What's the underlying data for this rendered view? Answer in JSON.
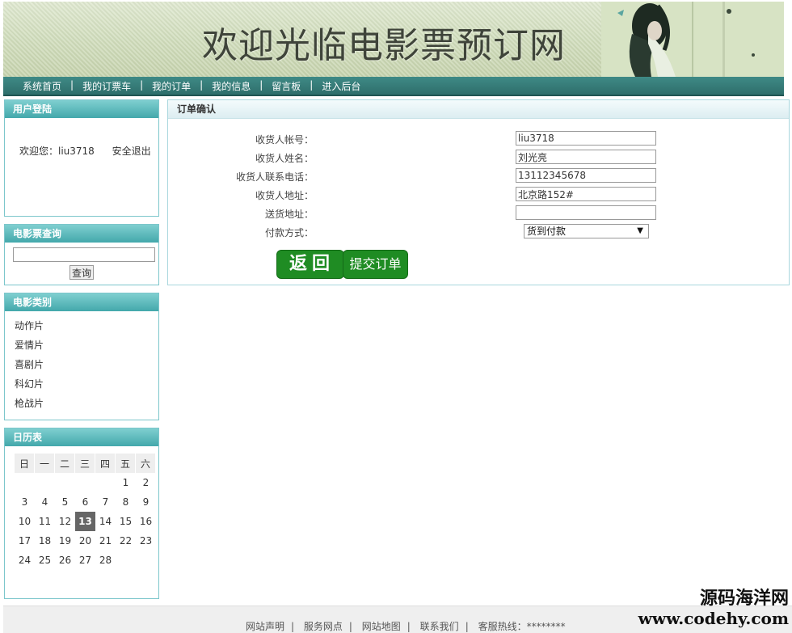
{
  "header": {
    "title": "欢迎光临电影票预订网"
  },
  "nav": {
    "items": [
      "系统首页",
      "我的订票车",
      "我的订单",
      "我的信息",
      "留言板",
      "进入后台"
    ],
    "separator": "|"
  },
  "login": {
    "title": "用户登陆",
    "welcome": "欢迎您：liu3718",
    "logout": "安全退出"
  },
  "search": {
    "title": "电影票查询",
    "input_value": "",
    "button": "查询"
  },
  "categories": {
    "title": "电影类别",
    "items": [
      "动作片",
      "爱情片",
      "喜剧片",
      "科幻片",
      "枪战片"
    ]
  },
  "calendar": {
    "title": "日历表",
    "weekdays": [
      "日",
      "一",
      "二",
      "三",
      "四",
      "五",
      "六"
    ],
    "weeks": [
      [
        "",
        "",
        "",
        "",
        "",
        "1",
        "2"
      ],
      [
        "3",
        "4",
        "5",
        "6",
        "7",
        "8",
        "9"
      ],
      [
        "10",
        "11",
        "12",
        "13",
        "14",
        "15",
        "16"
      ],
      [
        "17",
        "18",
        "19",
        "20",
        "21",
        "22",
        "23"
      ],
      [
        "24",
        "25",
        "26",
        "27",
        "28",
        "",
        ""
      ]
    ],
    "today": "13"
  },
  "order": {
    "title": "订单确认",
    "account_label": "收货人帐号：",
    "account_value": "liu3718",
    "name_label": "收货人姓名：",
    "name_value": "刘光亮",
    "phone_label": "收货人联系电话：",
    "phone_value": "13112345678",
    "address_label": "收货人地址：",
    "address_value": "北京路152#",
    "delivery_label": "送货地址：",
    "delivery_value": "",
    "payment_label": "付款方式：",
    "payment_value": "货到付款",
    "back_button": "返回",
    "submit_button": "提交订单"
  },
  "footer": {
    "links": [
      "网站声明",
      "服务网点",
      "网站地图",
      "联系我们",
      "客服热线：********"
    ]
  },
  "watermark": {
    "line1": "源码海洋网",
    "line2": "www.codehy.com"
  },
  "colors": {
    "nav_bg": "#2e6e6b",
    "side_head": "#43a8ab",
    "button_green": "#1f8c23"
  }
}
